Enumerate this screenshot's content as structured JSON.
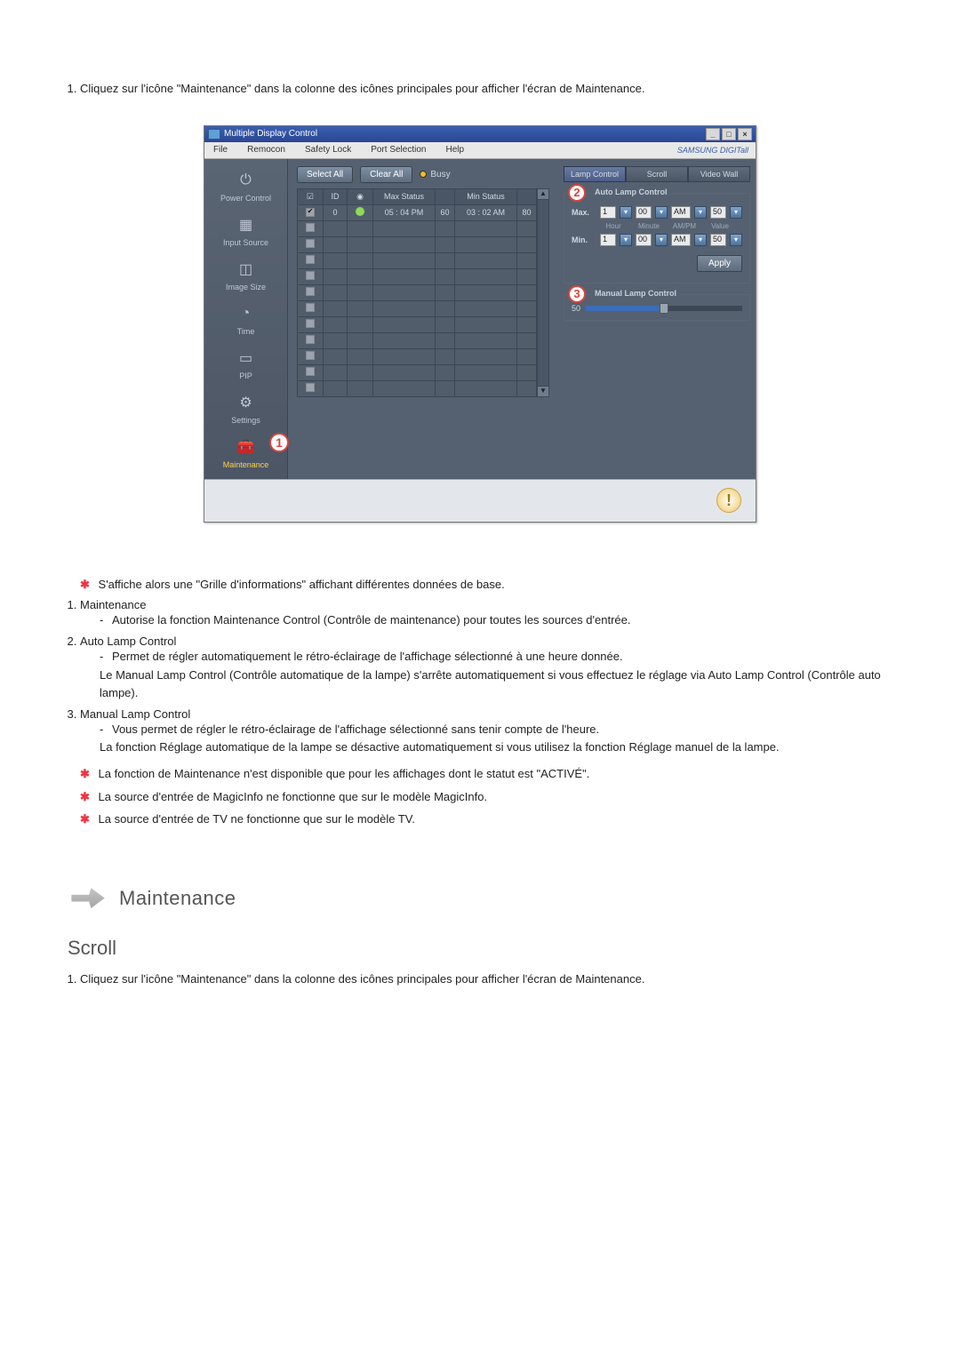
{
  "intro_item": "Cliquez sur l'icône \"Maintenance\" dans la colonne des icônes principales pour afficher l'écran de Maintenance.",
  "app": {
    "title": "Multiple Display Control",
    "window_buttons": {
      "min": "_",
      "max": "□",
      "close": "×"
    },
    "menu": [
      "File",
      "Remocon",
      "Safety Lock",
      "Port Selection",
      "Help"
    ],
    "brand": "SAMSUNG DIGITall",
    "toolbar": {
      "select_all": "Select All",
      "clear_all": "Clear All",
      "busy": "Busy"
    },
    "sidebar": [
      {
        "label": "Power Control",
        "icon": "⏻"
      },
      {
        "label": "Input Source",
        "icon": "▦"
      },
      {
        "label": "Image Size",
        "icon": "◫"
      },
      {
        "label": "Time",
        "icon": "◔"
      },
      {
        "label": "PIP",
        "icon": "▭"
      },
      {
        "label": "Settings",
        "icon": "⚙"
      },
      {
        "label": "Maintenance",
        "icon": "🧰",
        "active": true,
        "callout": "1"
      }
    ],
    "grid": {
      "headers": {
        "chk": "☑",
        "id": "ID",
        "status": "◉",
        "max": "Max Status",
        "maxv": "",
        "min": "Min Status",
        "minv": ""
      },
      "row": {
        "id": "0",
        "max_time": "05 : 04 PM",
        "max_val": "60",
        "min_time": "03 : 02 AM",
        "min_val": "80"
      }
    },
    "tabs": {
      "lamp": "Lamp Control",
      "scroll": "Scroll",
      "video": "Video Wall"
    },
    "auto_lamp": {
      "title": "Auto Lamp Control",
      "callout": "2",
      "max_label": "Max.",
      "min_label": "Min.",
      "hour": "1",
      "minute": "00",
      "ampm": "AM",
      "value": "50",
      "sublabels": [
        "Hour",
        "Minute",
        "AM/PM",
        "Value"
      ],
      "apply": "Apply"
    },
    "manual_lamp": {
      "title": "Manual Lamp Control",
      "callout": "3",
      "value": "50",
      "pct": 50
    }
  },
  "notes": {
    "n1": "S'affiche alors une \"Grille d'informations\" affichant différentes données de base.",
    "list": [
      {
        "t": "Maintenance",
        "d": "Autorise la fonction Maintenance Control (Contrôle de maintenance) pour toutes les sources d'entrée."
      },
      {
        "t": "Auto Lamp Control",
        "d": "Permet de régler automatiquement le rétro-éclairage de l'affichage sélectionné à une heure donnée.",
        "d2": "Le Manual Lamp Control (Contrôle automatique de la lampe) s'arrête automatiquement si vous effectuez le réglage via Auto Lamp Control (Contrôle auto lampe)."
      },
      {
        "t": "Manual Lamp Control",
        "d": "Vous permet de régler le rétro-éclairage de l'affichage sélectionné sans tenir compte de l'heure.",
        "d2": "La fonction Réglage automatique de la lampe se désactive automatiquement si vous utilisez la fonction Réglage manuel de la lampe."
      }
    ],
    "n2": "La fonction de Maintenance n'est disponible que pour les affichages dont le statut est \"ACTIVÉ\".",
    "n3": "La source d'entrée de MagicInfo ne fonctionne que sur le modèle MagicInfo.",
    "n4": "La source d'entrée de TV ne fonctionne que sur le modèle TV."
  },
  "section_heading": "Maintenance",
  "subheading": "Scroll",
  "intro_item2": "Cliquez sur l'icône \"Maintenance\" dans la colonne des icônes principales pour afficher l'écran de Maintenance."
}
